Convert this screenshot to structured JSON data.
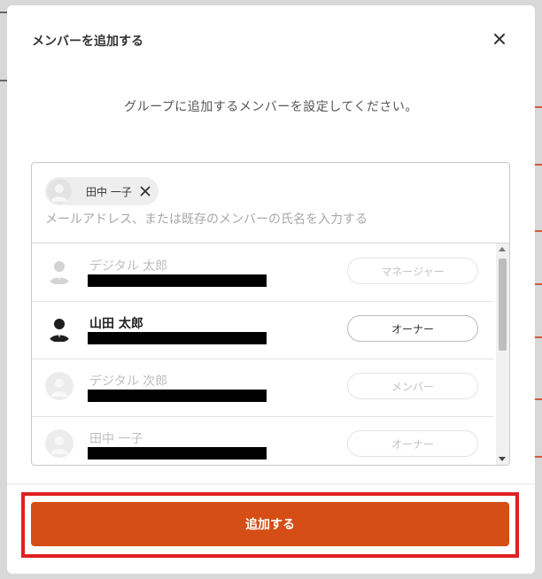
{
  "modal": {
    "title": "メンバーを追加する",
    "description": "グループに追加するメンバーを設定してください。",
    "close_icon": "close-icon"
  },
  "picker": {
    "selected": [
      {
        "name": "田中 一子",
        "avatar_icon": "user-placeholder-icon"
      }
    ],
    "search_placeholder": "メールアドレス、または既存のメンバーの氏名を入力する",
    "search_value": ""
  },
  "members": [
    {
      "name": "デジタル 太郎",
      "email": "",
      "role": "マネージャー",
      "state": "disabled",
      "avatar_icon": "user-suit-icon"
    },
    {
      "name": "山田 太郎",
      "email": "",
      "role": "オーナー",
      "state": "active",
      "avatar_icon": "user-suit-icon"
    },
    {
      "name": "デジタル 次郎",
      "email": "",
      "role": "メンバー",
      "state": "disabled",
      "avatar_icon": "user-placeholder-icon"
    },
    {
      "name": "田中 一子",
      "email": "",
      "role": "オーナー",
      "state": "disabled",
      "avatar_icon": "user-placeholder-icon"
    }
  ],
  "footer": {
    "submit_label": "追加する"
  },
  "colors": {
    "primary": "#d44e15",
    "highlight": "#e02020"
  }
}
